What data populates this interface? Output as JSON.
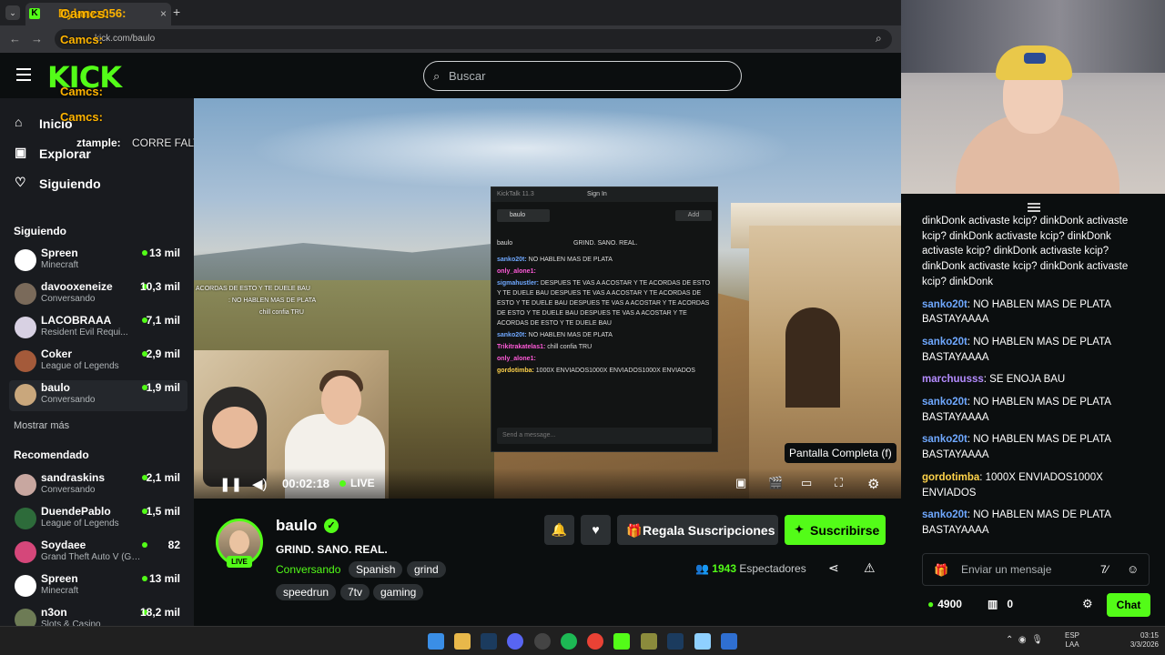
{
  "browser": {
    "tab_title": "Dylanzz056:",
    "url": "kick.com/baulo"
  },
  "header": {
    "logo": "KICK",
    "search_placeholder": "Buscar"
  },
  "nav": {
    "home": "Inicio",
    "explore": "Explorar",
    "following": "Siguiendo"
  },
  "sidebar": {
    "following_title": "Siguiendo",
    "following": [
      {
        "name": "Spreen",
        "category": "Minecraft",
        "viewers": "13 mil",
        "color": "#ffffff"
      },
      {
        "name": "davooxeneize",
        "category": "Conversando",
        "viewers": "10,3 mil",
        "color": "#7a6a5a"
      },
      {
        "name": "LACOBRAAA",
        "category": "Resident Evil Requi...",
        "viewers": "7,1 mil",
        "color": "#d8d1e3"
      },
      {
        "name": "Coker",
        "category": "League of Legends",
        "viewers": "2,9 mil",
        "color": "#a45a3a"
      },
      {
        "name": "baulo",
        "category": "Conversando",
        "viewers": "1,9 mil",
        "color": "#c9a77c"
      }
    ],
    "show_more": "Mostrar más",
    "recommended_title": "Recomendado",
    "recommended": [
      {
        "name": "sandraskins",
        "category": "Conversando",
        "viewers": "2,1 mil",
        "color": "#c8a7a0"
      },
      {
        "name": "DuendePablo",
        "category": "League of Legends",
        "viewers": "1,5 mil",
        "color": "#2d6b3a"
      },
      {
        "name": "Soydaee",
        "category": "Grand Theft Auto V (GTA)",
        "viewers": "82",
        "color": "#d5477a"
      },
      {
        "name": "Spreen",
        "category": "Minecraft",
        "viewers": "13 mil",
        "color": "#ffffff"
      },
      {
        "name": "n3on",
        "category": "Slots & Casino",
        "viewers": "18,2 mil",
        "color": "#6d7b55"
      }
    ]
  },
  "overlay": {
    "line1": "Camcs:",
    "line2": "Camcs:",
    "line3": "Camcs:",
    "zt_user": "ztample:",
    "zt_msg": "CORRE FALTA 10 MIN"
  },
  "embedded_chat": {
    "title": "KickTalk 11.3",
    "signin": "Sign In",
    "channel": "baulo",
    "add": "Add",
    "header_user": "baulo",
    "header_title": "GRIND. SANO. REAL.",
    "lines": [
      {
        "user": "sanko20t:",
        "text": "NO HABLEN MAS DE PLATA",
        "cls": "u1"
      },
      {
        "user": "only_alone1:",
        "text": "",
        "cls": "u2"
      },
      {
        "user": "sigmahustler:",
        "text": "DESPUES TE VAS A ACOSTAR Y TE ACORDAS DE ESTO Y TE DUELE BAU DESPUES TE VAS A ACOSTAR Y TE ACORDAS DE ESTO Y TE DUELE BAU DESPUES TE VAS A ACOSTAR Y TE ACORDAS DE ESTO Y TE DUELE BAU DESPUES TE VAS A ACOSTAR Y TE ACORDAS DE ESTO Y TE DUELE BAU",
        "cls": "u1"
      },
      {
        "user": "sanko20t:",
        "text": "NO HABLEN MAS DE PLATA",
        "cls": "u1"
      },
      {
        "user": "Trikitrakatelas1:",
        "text": "chill confia TRU",
        "cls": "u2"
      },
      {
        "user": "only_alone1:",
        "text": "",
        "cls": "u2"
      },
      {
        "user": "gordotimba:",
        "text": "1000X ENVIADOS1000X ENVIADOS1000X ENVIADOS",
        "cls": "u3"
      }
    ],
    "input_placeholder": "Send a message..."
  },
  "video_overlay": {
    "l1": "ACORDAS DE ESTO Y TE DUELE BAU",
    "l2": ": NO HABLEN MAS DE PLATA",
    "l3": "chill confia TRU"
  },
  "player": {
    "time": "00:02:18",
    "live": "LIVE",
    "tooltip": "Pantalla Completa (f)"
  },
  "channel": {
    "name": "baulo",
    "live_badge": "LIVE",
    "title": "GRIND. SANO. REAL.",
    "category": "Conversando",
    "tags": [
      "Spanish",
      "grind",
      "speedrun",
      "7tv",
      "gaming"
    ],
    "gift_label": "Regala Suscripciones",
    "sub_label": "Suscribirse",
    "viewers_count": "1943",
    "viewers_label": "Espectadores"
  },
  "chat": {
    "messages": [
      {
        "user": "",
        "user_color": "#ffffff",
        "text": "dinkDonk activaste kcip? dinkDonk activaste kcip? dinkDonk activaste kcip? dinkDonk activaste kcip? dinkDonk activaste kcip? dinkDonk activaste kcip? dinkDonk activaste kcip? dinkDonk"
      },
      {
        "user": "sanko20t",
        "user_color": "#6fa8ff",
        "text": "NO HABLEN MAS DE PLATA BASTAYAAAA"
      },
      {
        "user": "sanko20t",
        "user_color": "#6fa8ff",
        "text": "NO HABLEN MAS DE PLATA BASTAYAAAA"
      },
      {
        "user": "marchuusss",
        "user_color": "#b48cff",
        "text": "SE ENOJA BAU"
      },
      {
        "user": "sanko20t",
        "user_color": "#6fa8ff",
        "text": "NO HABLEN MAS DE PLATA BASTAYAAAA"
      },
      {
        "user": "sanko20t",
        "user_color": "#6fa8ff",
        "text": "NO HABLEN MAS DE PLATA BASTAYAAAA"
      },
      {
        "user": "gordotimba",
        "user_color": "#ffd34a",
        "text": "1000X ENVIADOS1000X ENVIADOS"
      },
      {
        "user": "sanko20t",
        "user_color": "#6fa8ff",
        "text": "NO HABLEN MAS DE PLATA BASTAYAAAA"
      }
    ],
    "input_placeholder": "Enviar un mensaje",
    "points": "4900",
    "store_count": "0",
    "chat_button": "Chat"
  },
  "taskbar": {
    "lang_line1": "ESP",
    "lang_line2": "LAA",
    "time": "03:15",
    "date": "3/3/2026"
  },
  "colors": {
    "accent": "#53fc18",
    "bg": "#0b0e0f",
    "sidebar": "#191b1f"
  }
}
